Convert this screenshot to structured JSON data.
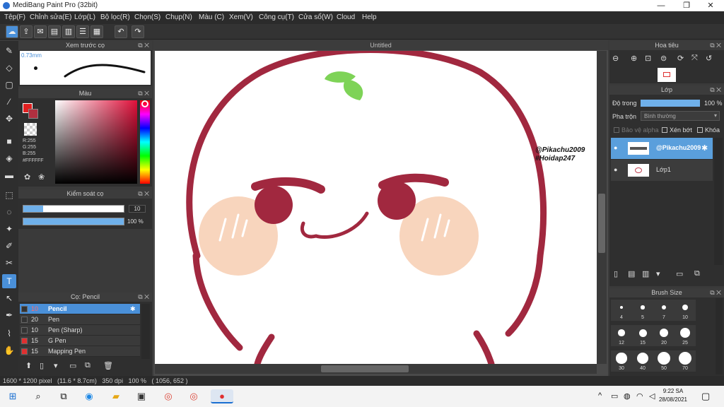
{
  "window": {
    "title": "MediBang Paint Pro (32bit)",
    "minimize": "—",
    "maximize": "❐",
    "close": "✕"
  },
  "menu": [
    "Tệp(F)",
    "Chỉnh sửa(E)",
    "Lớp(L)",
    "Bộ lọc(R)",
    "Chọn(S)",
    "Chụp(N)",
    "Màu (C)",
    "Xem(V)",
    "Công cụ(T)",
    "Cửa sổ(W)",
    "Cloud",
    "Help"
  ],
  "panels": {
    "preview": {
      "title": "Xem trước cọ",
      "size": "0.73mm"
    },
    "color": {
      "title": "Màu",
      "r": "R:255",
      "g": "G:255",
      "b": "B:255",
      "hex": "#FFFFFF"
    },
    "brush_control": {
      "title": "Kiểm soát cọ",
      "size_value": "10",
      "opacity_value": "100 %",
      "size_fraction": 0.2,
      "opacity_fraction": 1.0
    },
    "brush_list": {
      "title": "Cọ: Pencil",
      "items": [
        {
          "size": "10",
          "name": "Pencil",
          "color": "#333333",
          "selected": true
        },
        {
          "size": "20",
          "name": "Pen",
          "color": "#333333"
        },
        {
          "size": "10",
          "name": "Pen (Sharp)",
          "color": "#333333"
        },
        {
          "size": "15",
          "name": "G Pen",
          "color": "#e03030"
        },
        {
          "size": "15",
          "name": "Mapping Pen",
          "color": "#e03030"
        }
      ]
    },
    "navigator": {
      "title": "Hoa tiêu"
    },
    "layer": {
      "title": "Lớp",
      "opacity_label": "Độ trong",
      "opacity_value": "100 %",
      "blend_label": "Pha trộn",
      "blend_value": "Bình thường",
      "protect_alpha": "Bảo vệ alpha",
      "clipping": "Xén bớt",
      "lock": "Khóa",
      "layers": [
        {
          "name": "@Pikachu2009",
          "selected": true
        },
        {
          "name": "Lớp1",
          "selected": false
        }
      ]
    },
    "brush_size": {
      "title": "Brush Size",
      "sizes": [
        "4",
        "5",
        "7",
        "10",
        "12",
        "15",
        "20",
        "25",
        "30",
        "40",
        "50",
        "70"
      ]
    }
  },
  "canvas": {
    "tab_title": "Untitled",
    "watermark_line1": "@Pikachu2009",
    "watermark_line2": "#Hoidap247"
  },
  "status": {
    "text": "1600 * 1200 pixel   (11.6 * 8.7cm)   350 dpi   100 %   ( 1056, 652 )"
  },
  "taskbar": {
    "time": "9:22 SA",
    "date": "28/08/2021"
  }
}
